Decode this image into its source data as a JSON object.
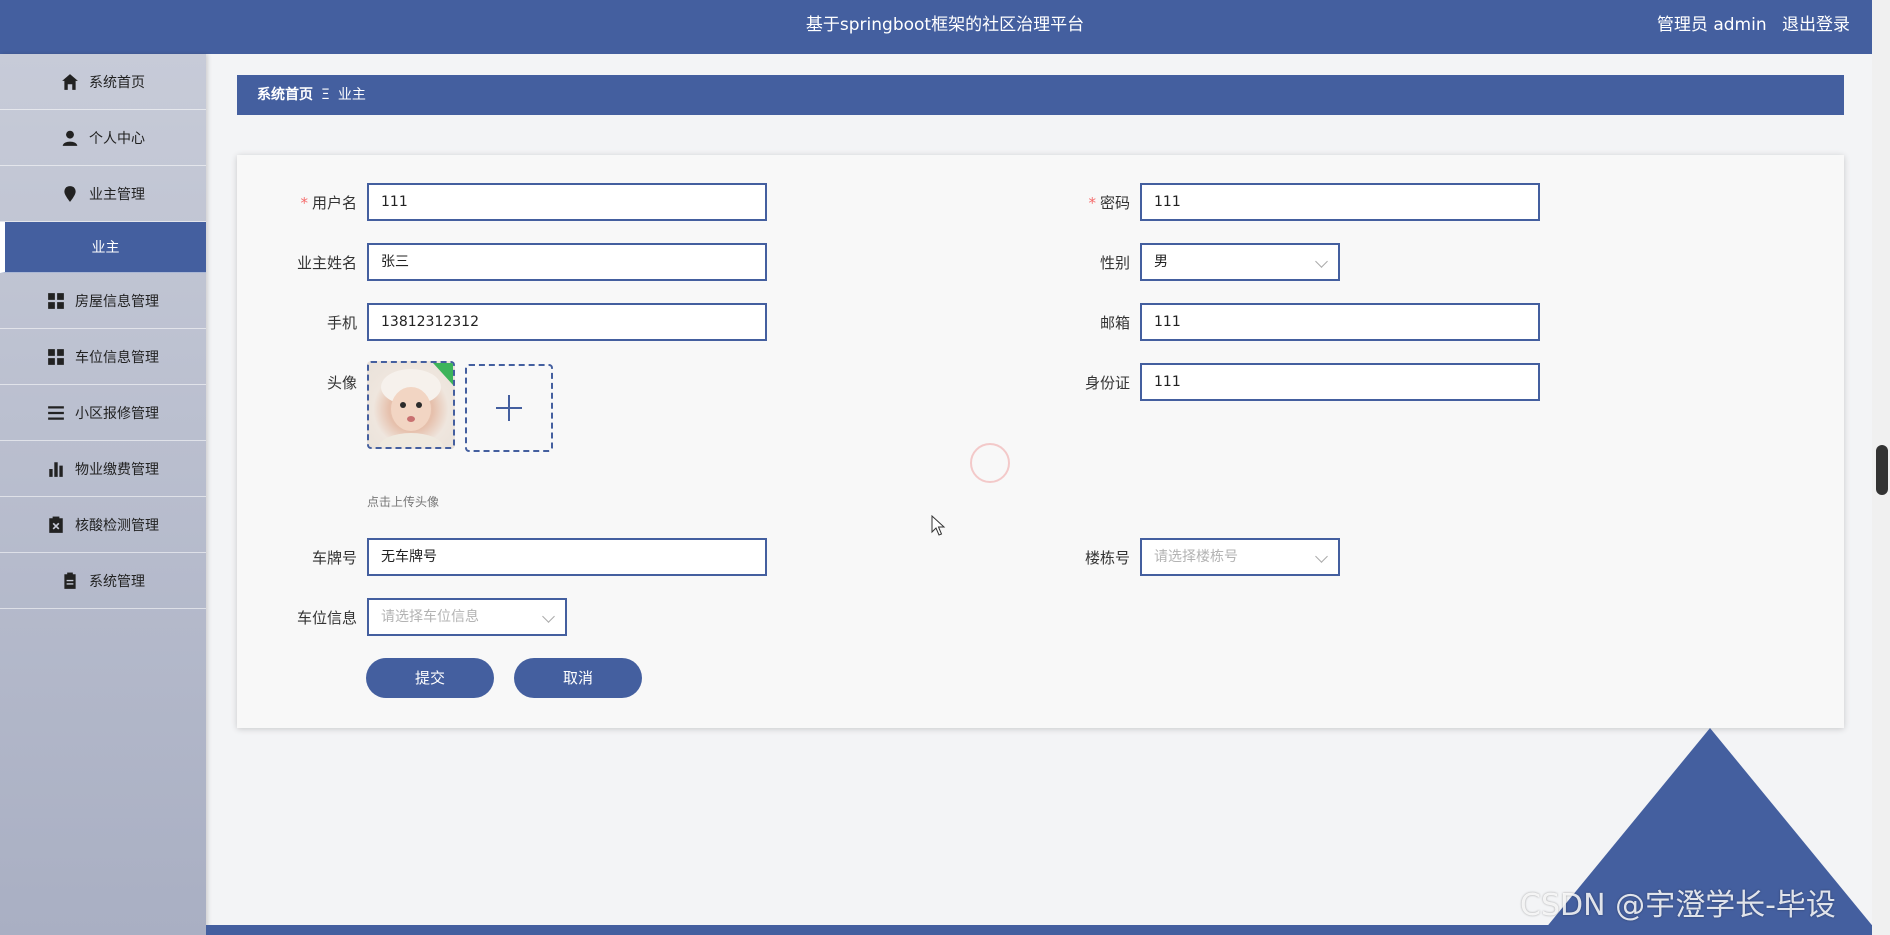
{
  "header": {
    "title": "基于springboot框架的社区治理平台",
    "user": "管理员 admin",
    "logout": "退出登录"
  },
  "sidebar": {
    "items": [
      {
        "label": "系统首页",
        "icon": "home-icon"
      },
      {
        "label": "个人中心",
        "icon": "user-icon"
      },
      {
        "label": "业主管理",
        "icon": "pin-icon"
      },
      {
        "label": "业主",
        "active": true
      },
      {
        "label": "房屋信息管理",
        "icon": "grid-icon"
      },
      {
        "label": "车位信息管理",
        "icon": "grid-icon"
      },
      {
        "label": "小区报修管理",
        "icon": "list-icon"
      },
      {
        "label": "物业缴费管理",
        "icon": "bar-chart-icon"
      },
      {
        "label": "核酸检测管理",
        "icon": "clipboard-x-icon"
      },
      {
        "label": "系统管理",
        "icon": "clipboard-icon"
      }
    ]
  },
  "breadcrumb": {
    "home": "系统首页",
    "sep": "Ξ",
    "current": "业主"
  },
  "form": {
    "username": {
      "label": "用户名",
      "required": "*",
      "value": "111"
    },
    "password": {
      "label": "密码",
      "required": "*",
      "value": "111"
    },
    "owner_name": {
      "label": "业主姓名",
      "value": "张三"
    },
    "gender": {
      "label": "性别",
      "value": "男"
    },
    "phone": {
      "label": "手机",
      "value": "13812312312"
    },
    "email": {
      "label": "邮箱",
      "value": "111"
    },
    "avatar": {
      "label": "头像",
      "tip": "点击上传头像"
    },
    "id_card": {
      "label": "身份证",
      "value": "111"
    },
    "plate": {
      "label": "车牌号",
      "value": "无车牌号"
    },
    "building": {
      "label": "楼栋号",
      "placeholder": "请选择楼栋号"
    },
    "parking": {
      "label": "车位信息",
      "placeholder": "请选择车位信息"
    },
    "submit": "提交",
    "cancel": "取消"
  },
  "watermark": "CSDN @宇澄学长-毕设",
  "colors": {
    "primary": "#445f9f",
    "required": "#f56c6c"
  }
}
